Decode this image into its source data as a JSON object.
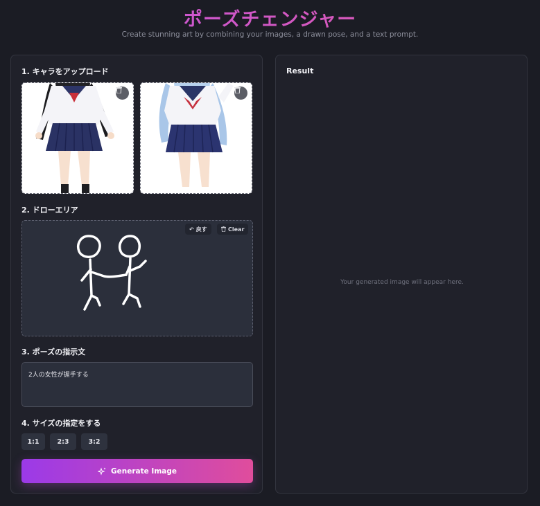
{
  "header": {
    "title": "ポーズチェンジャー",
    "subtitle": "Create stunning art by combining your images, a drawn pose, and a text prompt."
  },
  "left": {
    "upload": {
      "heading": "1. キャラをアップロード",
      "images": [
        {
          "alt": "Anime girl with long black hair in sailor uniform"
        },
        {
          "alt": "Anime girl with long light-blue hair in sailor uniform"
        }
      ]
    },
    "draw": {
      "heading": "2. ドローエリア",
      "undo_label": "戻す",
      "clear_label": "Clear"
    },
    "prompt": {
      "heading": "3. ポーズの指示文",
      "value": "2人の女性が握手する"
    },
    "size": {
      "heading": "4. サイズの指定をする",
      "options": [
        "1:1",
        "2:3",
        "3:2"
      ]
    },
    "generate_label": "Generate Image"
  },
  "right": {
    "heading": "Result",
    "placeholder": "Your generated image will appear here."
  },
  "colors": {
    "accent_start": "#9b3ae8",
    "accent_end": "#e04d9c",
    "title_start": "#c255e0",
    "title_end": "#e05aa8",
    "background": "#1b1c24",
    "panel": "#20212a"
  }
}
